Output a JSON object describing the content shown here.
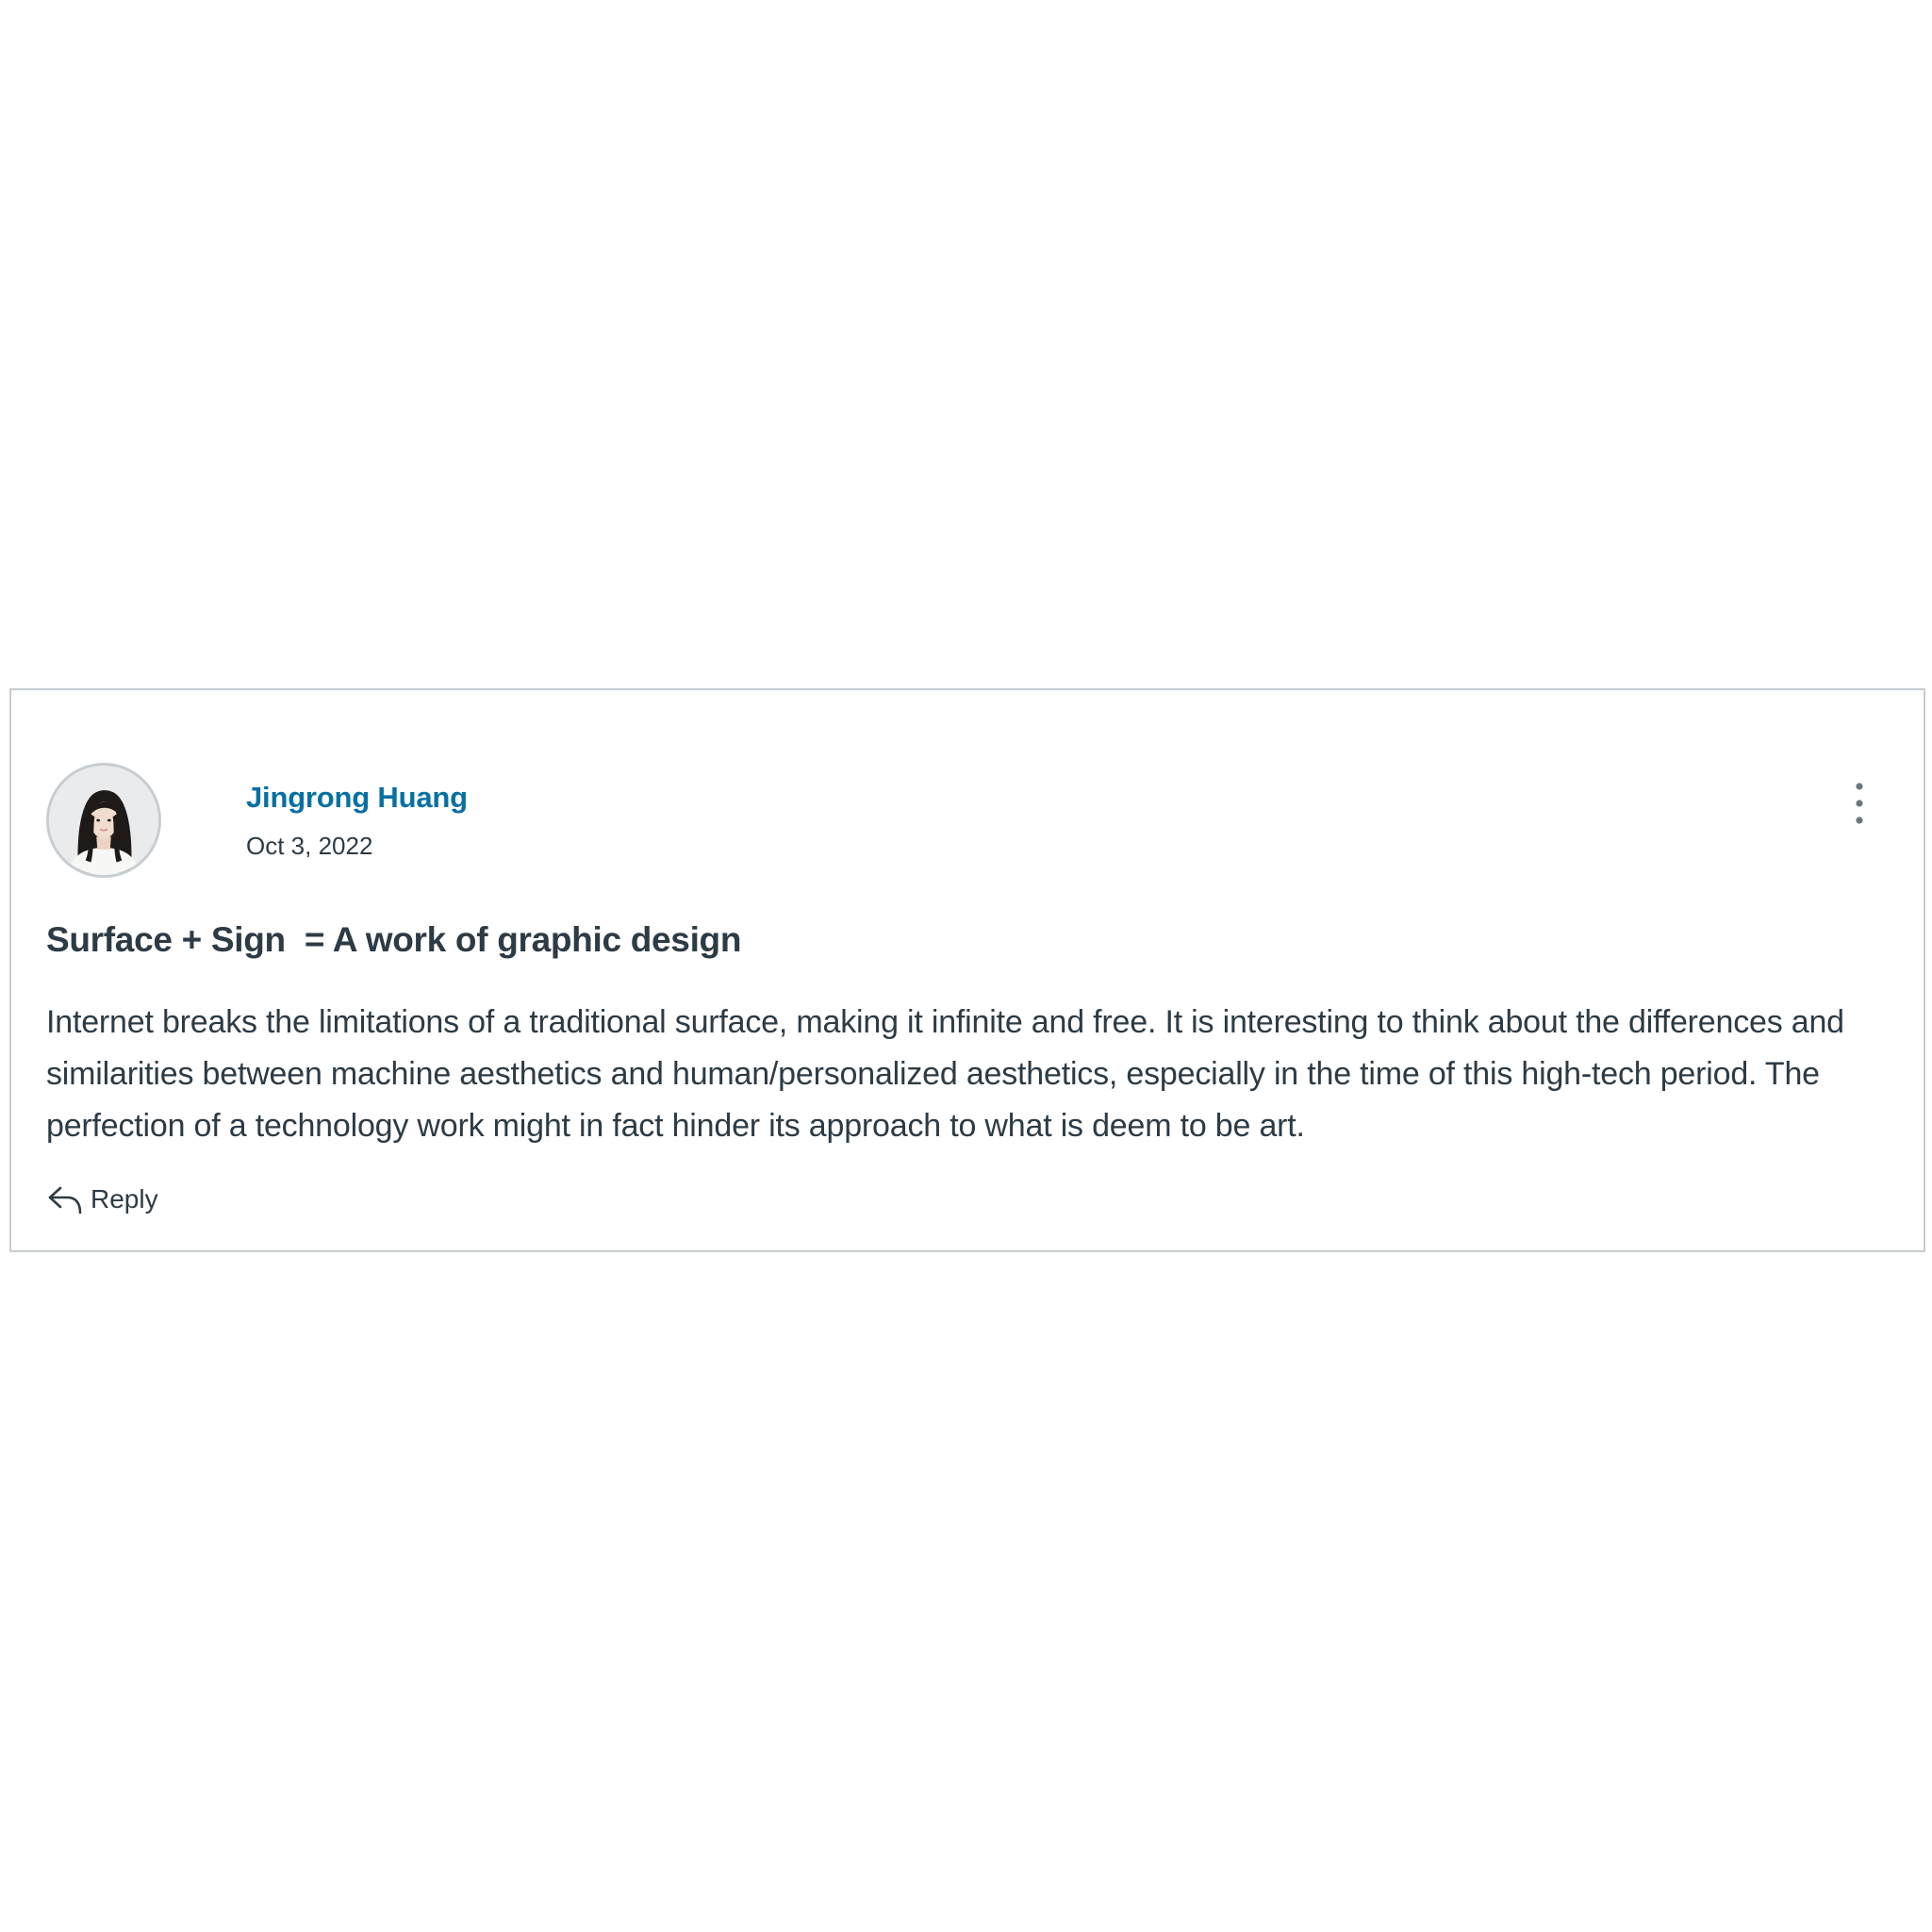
{
  "post": {
    "author": {
      "name": "Jingrong Huang",
      "avatar": "avatar-photo"
    },
    "date": "Oct 3, 2022",
    "title": "Surface + Sign  = A work of graphic design",
    "body": "Internet breaks the limitations of a traditional surface, making it infinite and free. It is interesting to think about the differences and similarities between machine aesthetics and human/personalized aesthetics, especially in the time of this high-tech period. The perfection of a technology work might in fact hinder its approach to what is deem to be art.",
    "actions": {
      "reply_label": "Reply",
      "reply_icon": "reply-arrow-icon",
      "more_icon": "vertical-ellipsis-icon"
    }
  },
  "colors": {
    "link": "#0770a3",
    "text": "#2d3b45",
    "border": "#c7cdd1"
  }
}
